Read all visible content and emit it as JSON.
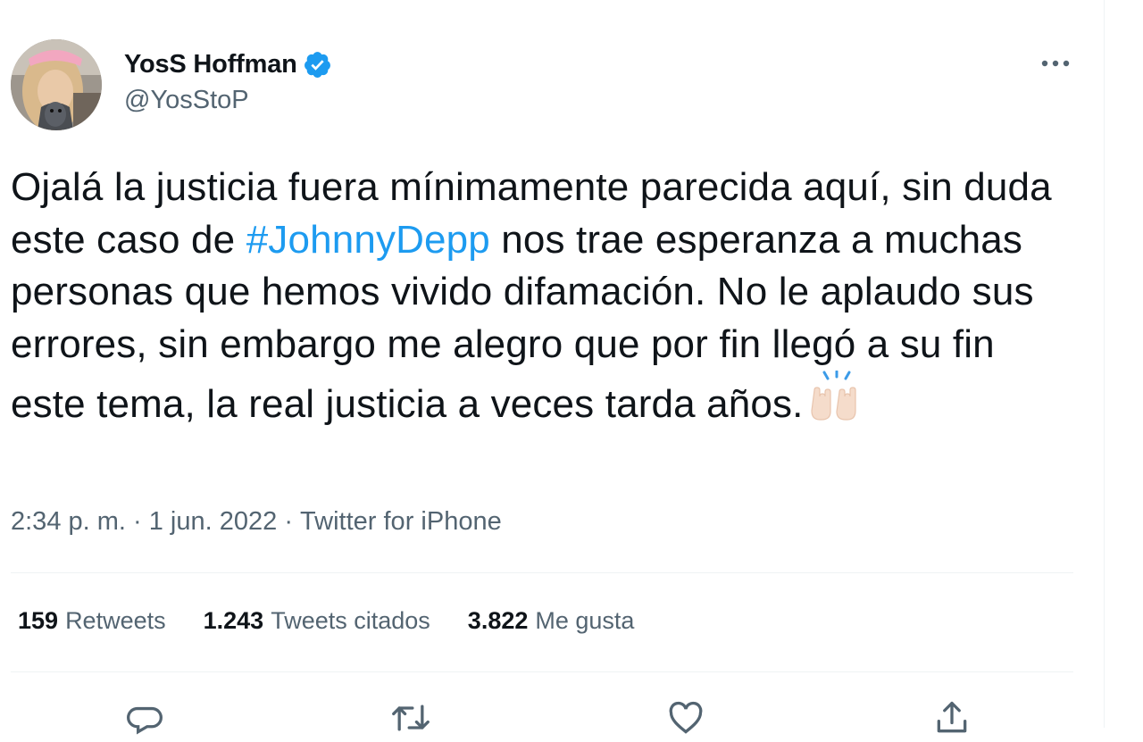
{
  "tweet": {
    "author": {
      "name": "YosS Hoffman",
      "handle": "@YosStoP",
      "verified": true,
      "verified_color": "#1d9bf0"
    },
    "text": {
      "before": "Ojalá la justicia fuera mínimamente parecida aquí, sin duda este caso de ",
      "hashtag": "#JohnnyDepp",
      "after": " nos trae esperanza a muchas personas que hemos vivido difamación. No le aplaudo sus errores, sin embargo me alegro que por fin llegó a su fin este tema, la real justicia a veces tarda años.",
      "emoji": "raised-hands"
    },
    "meta": {
      "time": "2:34 p. m.",
      "separator": " · ",
      "date": "1 jun. 2022",
      "source": "Twitter for iPhone"
    },
    "stats": [
      {
        "count": "159",
        "label": "Retweets"
      },
      {
        "count": "1.243",
        "label": "Tweets citados"
      },
      {
        "count": "3.822",
        "label": "Me gusta"
      }
    ],
    "actions": [
      "reply-icon",
      "retweet-icon",
      "like-icon",
      "share-icon"
    ],
    "colors": {
      "accent": "#1d9bf0",
      "text": "#0f1419",
      "secondary": "#536471",
      "divider": "#eff3f4"
    }
  }
}
